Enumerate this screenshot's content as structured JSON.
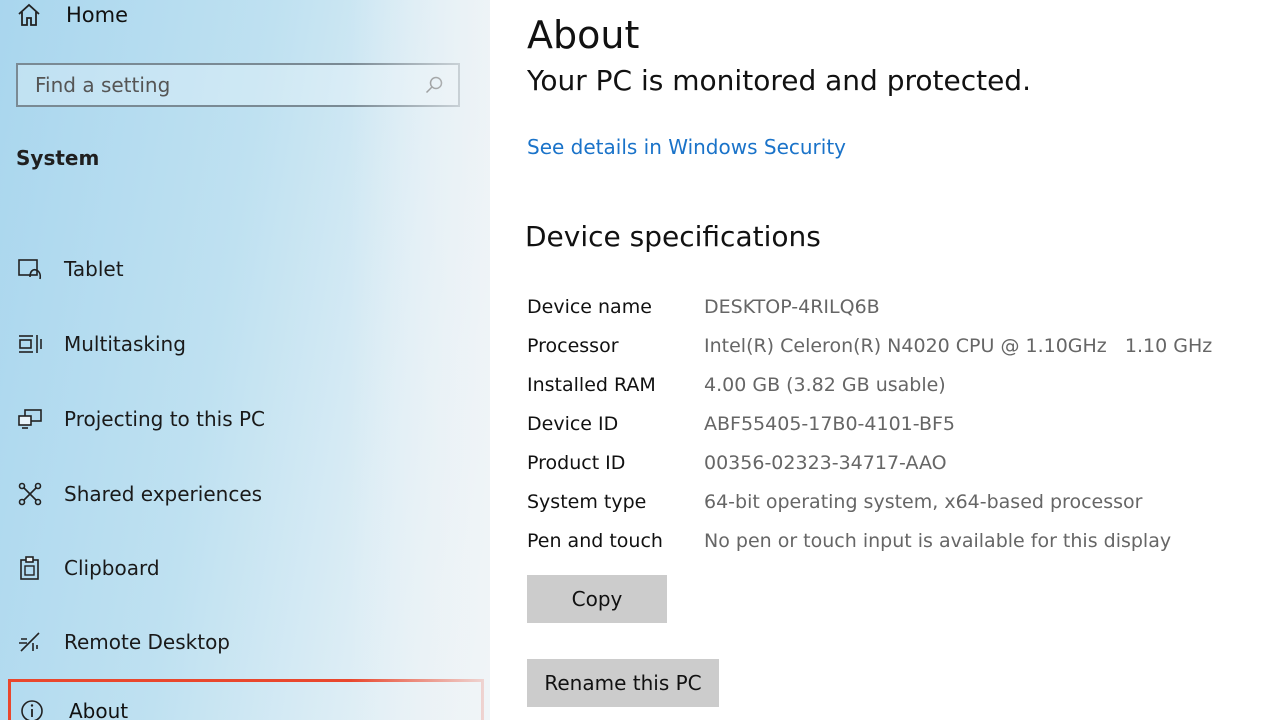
{
  "sidebar": {
    "home_label": "Home",
    "search_placeholder": "Find a setting",
    "section_title": "System",
    "items": [
      {
        "label": "Tablet",
        "icon": "tablet-icon"
      },
      {
        "label": "Multitasking",
        "icon": "multitasking-icon"
      },
      {
        "label": "Projecting to this PC",
        "icon": "projecting-icon"
      },
      {
        "label": "Shared experiences",
        "icon": "shared-experiences-icon"
      },
      {
        "label": "Clipboard",
        "icon": "clipboard-icon"
      },
      {
        "label": "Remote Desktop",
        "icon": "remote-desktop-icon"
      },
      {
        "label": "About",
        "icon": "info-icon",
        "highlighted": true
      }
    ],
    "highlight_color": "#e9472d"
  },
  "main": {
    "title": "About",
    "protection_status": "Your PC is monitored and protected.",
    "security_link": "See details in Windows Security",
    "specs_title": "Device specifications",
    "specs": [
      {
        "key": "Device name",
        "value": "DESKTOP-4RILQ6B"
      },
      {
        "key": "Processor",
        "value": "Intel(R) Celeron(R) N4020 CPU @ 1.10GHz   1.10 GHz"
      },
      {
        "key": "Installed RAM",
        "value": "4.00 GB (3.82 GB usable)"
      },
      {
        "key": "Device ID",
        "value": "ABF55405-17B0-4101-BF5"
      },
      {
        "key": "Product ID",
        "value": "00356-02323-34717-AAO"
      },
      {
        "key": "System type",
        "value": "64-bit operating system, x64-based processor"
      },
      {
        "key": "Pen and touch",
        "value": "No pen or touch input is available for this display"
      }
    ],
    "copy_button": "Copy",
    "rename_button": "Rename this PC",
    "link_color": "#1a73c9"
  }
}
